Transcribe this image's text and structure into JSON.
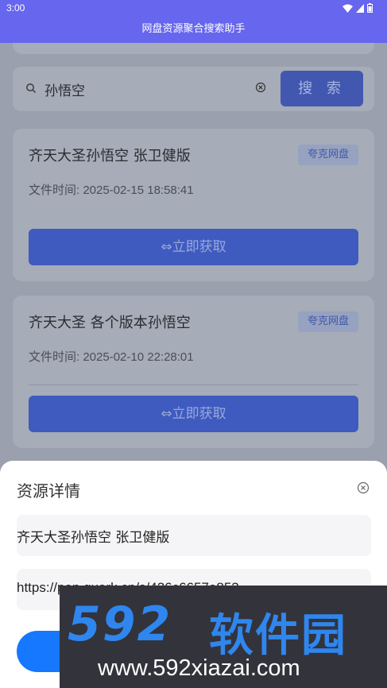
{
  "status_bar": {
    "time": "3:00"
  },
  "app": {
    "title": "网盘资源聚合搜索助手"
  },
  "search": {
    "query": "孙悟空",
    "button_label": "搜 索"
  },
  "results": [
    {
      "title": "齐天大圣孙悟空 张卫健版",
      "tag": "夸克网盘",
      "time": "文件时间: 2025-02-15 18:58:41",
      "action": "⇔立即获取"
    },
    {
      "title": "齐天大圣 各个版本孙悟空",
      "tag": "夸克网盘",
      "time": "文件时间: 2025-02-10 22:28:01",
      "action": "⇔立即获取"
    }
  ],
  "detail_sheet": {
    "title": "资源详情",
    "resource_name": "齐天大圣孙悟空 张卫健版",
    "link": "https://pan.quark.cn/s/426c6657a852"
  },
  "watermark": {
    "brand_digits": "592",
    "brand_name": "软件园",
    "url": "www.592xiazai.com"
  },
  "colors": {
    "header": "#6666ee",
    "accent": "#1677ff",
    "button_dimmed": "#3f5bbf"
  }
}
